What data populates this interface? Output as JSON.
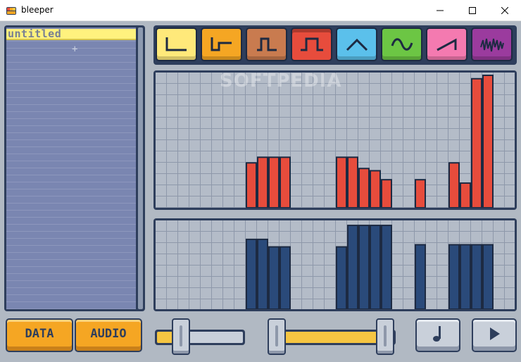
{
  "window": {
    "title": "bleeper",
    "controls": [
      "minimize-icon",
      "maximize-icon",
      "close-icon"
    ]
  },
  "songs": {
    "items": [
      {
        "label": "untitled",
        "selected": true
      }
    ]
  },
  "waveforms": [
    {
      "name": "square-wave-1",
      "color": "#ffe97a",
      "selected": false
    },
    {
      "name": "square-wave-2",
      "color": "#f5a623",
      "selected": false
    },
    {
      "name": "square-wave-3",
      "color": "#c97b4f",
      "selected": false
    },
    {
      "name": "pulse-wave",
      "color": "#e74c3c",
      "selected": true
    },
    {
      "name": "triangle-wave",
      "color": "#5bc0eb",
      "selected": false
    },
    {
      "name": "sine-wave",
      "color": "#6cc644",
      "selected": false
    },
    {
      "name": "sawtooth-wave",
      "color": "#f47ab0",
      "selected": false
    },
    {
      "name": "noise-wave",
      "color": "#9b3b9e",
      "selected": false
    }
  ],
  "chart_data": [
    {
      "type": "bar",
      "name": "pitch",
      "color": "#e74c3c",
      "steps": 30,
      "ylim": [
        0,
        11
      ],
      "values": [
        0,
        0,
        0,
        0,
        0,
        0,
        0,
        0,
        4,
        4.5,
        4.5,
        4.5,
        0,
        0,
        0,
        0,
        4.5,
        4.5,
        3.5,
        3.3,
        2.5,
        0,
        0,
        2.5,
        0,
        0,
        4,
        2.2,
        11.5,
        11.8
      ]
    },
    {
      "type": "bar",
      "name": "volume",
      "color": "#2a4a7a",
      "steps": 30,
      "ylim": [
        0,
        8
      ],
      "values": [
        0,
        0,
        0,
        0,
        0,
        0,
        0,
        0,
        6.5,
        6.5,
        5.8,
        5.8,
        0,
        0,
        0,
        0,
        5.8,
        7.8,
        7.8,
        7.8,
        7.8,
        0,
        0,
        6,
        0,
        0,
        6,
        6,
        6,
        6
      ]
    }
  ],
  "controls": {
    "data_label": "DATA",
    "audio_label": "AUDIO",
    "speed": 0.28,
    "range_start": 0.0,
    "range_end": 1.0
  },
  "watermark": "SOFTPEDIA",
  "colors": {
    "accent": "#f5a623",
    "dark": "#2e3e5c",
    "background": "#b1b9c3"
  }
}
